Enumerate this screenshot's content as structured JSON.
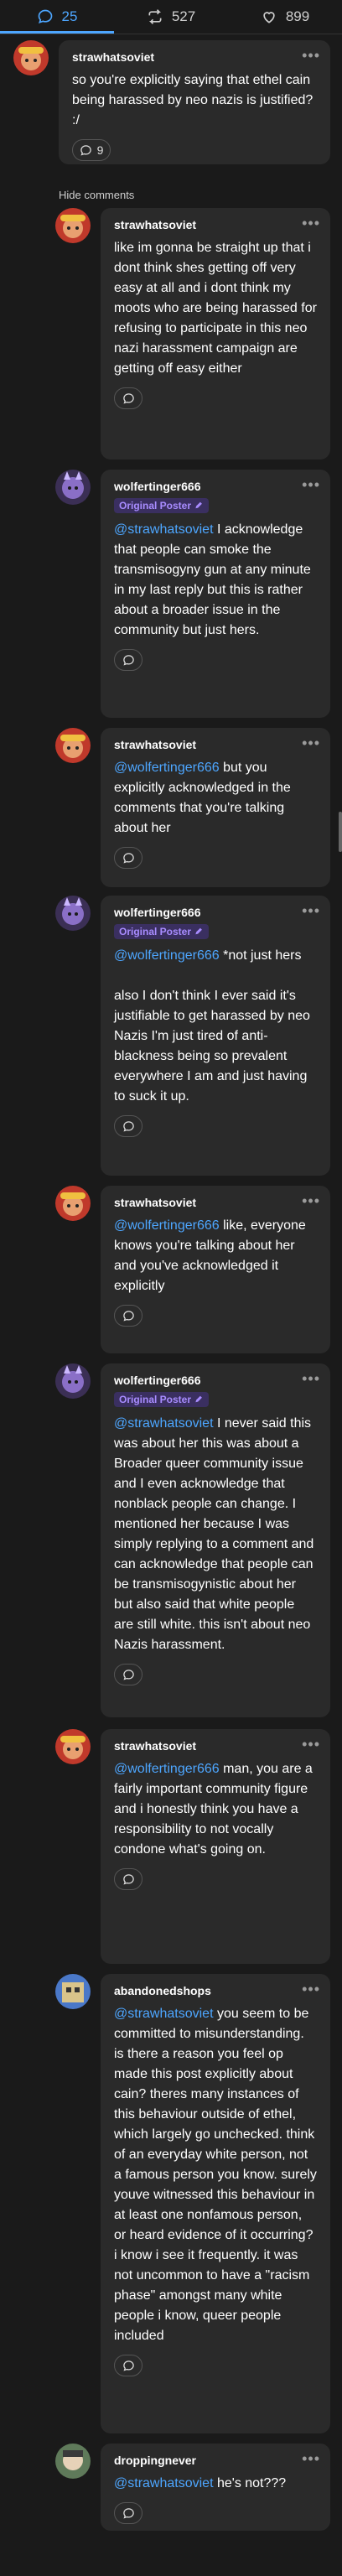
{
  "tabs": [
    {
      "label": "25",
      "icon": "speech-bubble-icon",
      "active": true
    },
    {
      "label": "527",
      "icon": "reblog-icon",
      "active": false
    },
    {
      "label": "899",
      "icon": "heart-icon",
      "active": false
    }
  ],
  "top_comment": {
    "username": "strawhatsoviet",
    "text": "so you're explicitly saying that ethel cain being harassed by neo nazis is justified? :/",
    "reply_count": "9"
  },
  "hide_comments_label": "Hide comments",
  "op_badge_label": "Original Poster",
  "replies": [
    {
      "username": "strawhatsoviet",
      "mention": "",
      "text": "like im gonna be straight up that i dont think shes getting off very easy at all and i dont think my moots who are being harassed for refusing to participate in this neo nazi harassment campaign are getting off easy either"
    },
    {
      "username": "wolfertinger666",
      "op": true,
      "mention": "@strawhatsoviet",
      "text": " I acknowledge that people can smoke the transmisogyny gun at any minute in my last reply but this is rather about a broader issue in the community but just hers."
    },
    {
      "username": "strawhatsoviet",
      "mention": "@wolfertinger666",
      "text": " but you explicitly acknowledged in the comments that you're talking about her"
    },
    {
      "username": "wolfertinger666",
      "op": true,
      "mention": "@wolfertinger666",
      "text": " *not just hers\n\nalso I don't think I ever said it's justifiable to get harassed by neo Nazis I'm just tired of anti-blackness being so prevalent everywhere I am and just having to suck it up."
    },
    {
      "username": "strawhatsoviet",
      "mention": "@wolfertinger666",
      "text": " like, everyone knows you're talking about her and you've acknowledged it explicitly"
    },
    {
      "username": "wolfertinger666",
      "op": true,
      "mention": "@strawhatsoviet",
      "text": " I never said this was about her this was about a Broader queer community issue and I even acknowledge that nonblack people can change. I mentioned her because I was simply replying to a comment and can acknowledge that people can be transmisogynistic about her but also said that white people are still white. this isn't about neo Nazis harassment."
    },
    {
      "username": "strawhatsoviet",
      "mention": "@wolfertinger666",
      "text": " man, you are a fairly important community figure and i honestly think you have a responsibility to not vocally condone what's going on."
    },
    {
      "username": "abandonedshops",
      "mention": "@strawhatsoviet",
      "text": " you seem to be committed to misunderstanding. is there a reason you feel op made this post explicitly about cain? theres many instances of this behaviour outside of ethel, which largely go unchecked. think of an everyday white person, not a famous person you know. surely youve witnessed this behaviour in at least one nonfamous person, or heard evidence of it occurring? i know i see it frequently. it was not uncommon to have a \"racism phase\" amongst many white people i know, queer people included"
    },
    {
      "username": "droppingnever",
      "mention": "@strawhatsoviet",
      "text": " he's not???"
    }
  ],
  "colors": {
    "accent": "#4da6ff",
    "op_badge_bg": "#3a2f60",
    "op_badge_text": "#a88cff",
    "card": "#2a2a2a",
    "page": "#1a1a1a"
  }
}
